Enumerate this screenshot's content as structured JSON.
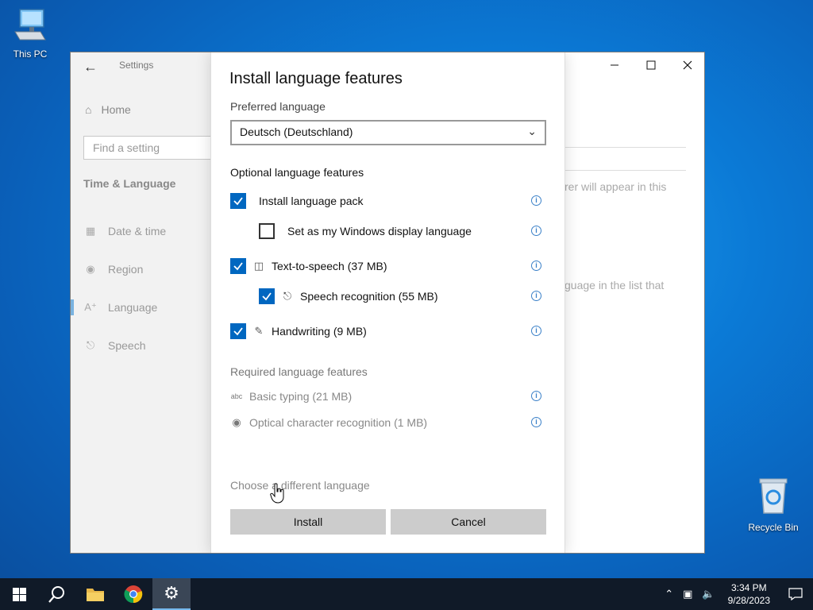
{
  "desktop": {
    "this_pc": "This PC",
    "recycle_bin": "Recycle Bin"
  },
  "window": {
    "app_title": "Settings",
    "sidebar": {
      "home": "Home",
      "search_placeholder": "Find a setting",
      "section": "Time & Language",
      "items": [
        {
          "label": "Date & time",
          "icon": "calendar-clock-icon"
        },
        {
          "label": "Region",
          "icon": "globe-icon"
        },
        {
          "label": "Language",
          "icon": "language-icon"
        },
        {
          "label": "Speech",
          "icon": "microphone-icon"
        }
      ]
    },
    "background_text": {
      "line1": "rer will appear in this",
      "line2": "guage in the list that"
    }
  },
  "dialog": {
    "title": "Install language features",
    "preferred_label": "Preferred language",
    "preferred_value": "Deutsch (Deutschland)",
    "optional_label": "Optional language features",
    "optional": [
      {
        "label": "Install language pack",
        "checked": true
      },
      {
        "label": "Set as my Windows display language",
        "checked": false
      },
      {
        "label": "Text-to-speech (37 MB)",
        "checked": true,
        "icon": "text-to-speech-icon"
      },
      {
        "label": "Speech recognition (55 MB)",
        "checked": true,
        "icon": "microphone-icon"
      },
      {
        "label": "Handwriting (9 MB)",
        "checked": true,
        "icon": "handwriting-icon"
      }
    ],
    "required_label": "Required language features",
    "required": [
      {
        "label": "Basic typing (21 MB)",
        "icon": "abc-check-icon"
      },
      {
        "label": "Optical character recognition (1 MB)",
        "icon": "camera-scan-icon"
      }
    ],
    "choose_link": "Choose a different language",
    "install_button": "Install",
    "cancel_button": "Cancel"
  },
  "taskbar": {
    "time": "3:34 PM",
    "date": "9/28/2023"
  },
  "colors": {
    "accent": "#0067c0",
    "taskbar": "#101a28"
  }
}
